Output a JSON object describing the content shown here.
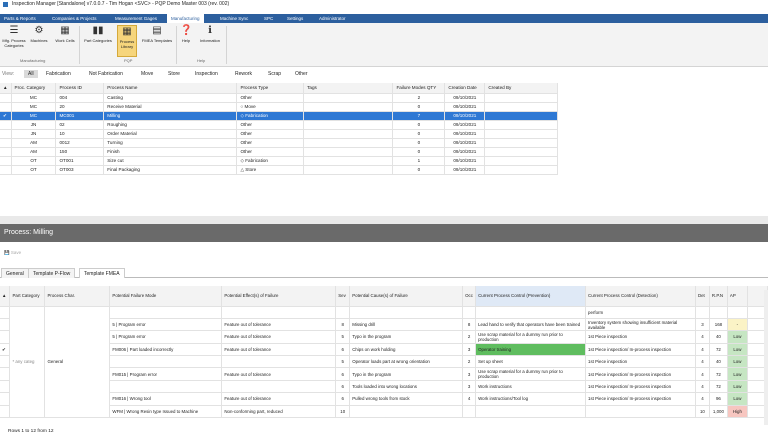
{
  "window": {
    "title": "Inspection Manager [Standalone] v7.0.0.7 - Tim Hogan <SVC> - PQP Demo Master 003 (rev. 002)"
  },
  "menu": [
    "Parts & Reports",
    "Companies & Projects",
    "Measurement Gages",
    "Manufacturing",
    "Machine Sync",
    "SPC",
    "Settings",
    "Administrator"
  ],
  "menu_active": "Manufacturing",
  "ribbon": {
    "manufacturing": [
      "Mfg. Process Categories",
      "Machines",
      "Work Cells"
    ],
    "pqp": [
      "Part Categories",
      "Process Library",
      "FMEA Templates"
    ],
    "help": [
      "Help",
      "Information"
    ],
    "group_labels": [
      "Manufacturing",
      "PQP",
      "Help"
    ]
  },
  "filters": {
    "view_label": "View:",
    "items": [
      "All",
      "Fabrication",
      "Not Fabrication",
      "Move",
      "Store",
      "Inspection",
      "Rework",
      "Scrap",
      "Other"
    ],
    "active": "All"
  },
  "process_table": {
    "headers": [
      "Proc. Category",
      "Process ID",
      "Process Name",
      "Process Type",
      "Tags",
      "Failure Modes QTY",
      "Creation Date",
      "Created By"
    ],
    "rows": [
      [
        "MC",
        "004",
        "Casting",
        "Other",
        "",
        "2",
        "09/10/2021",
        ""
      ],
      [
        "MC",
        "20",
        "Receive Material",
        "Move",
        "",
        "0",
        "09/10/2021",
        ""
      ],
      [
        "MC",
        "MC001",
        "Milling",
        "Fabrication",
        "",
        "7",
        "09/10/2021",
        ""
      ],
      [
        "JN",
        "02",
        "Roughing",
        "Other",
        "",
        "0",
        "09/10/2021",
        ""
      ],
      [
        "JN",
        "10",
        "Order Material",
        "Other",
        "",
        "0",
        "09/10/2021",
        ""
      ],
      [
        "AM",
        "0012",
        "Turning",
        "Other",
        "",
        "0",
        "09/10/2021",
        ""
      ],
      [
        "AM",
        "150",
        "Finish",
        "Other",
        "",
        "0",
        "09/10/2021",
        ""
      ],
      [
        "OT",
        "OT001",
        "Size cut",
        "Fabrication",
        "",
        "1",
        "09/10/2021",
        ""
      ],
      [
        "OT",
        "OT003",
        "Final Packaging",
        "Store",
        "",
        "0",
        "09/10/2021",
        ""
      ]
    ],
    "type_icons": [
      "",
      "circle-icon",
      "diamond-icon",
      "",
      "",
      "",
      "",
      "diamond-icon",
      "triangle-icon"
    ]
  },
  "process_panel": {
    "title": "Process: Milling",
    "save": "Save"
  },
  "tabs": [
    "General",
    "Template P-Flow",
    "Template FMEA"
  ],
  "tab_active": "Template FMEA",
  "fmea": {
    "headers": [
      "Part Category",
      "Process Char.",
      "Potential Failure Mode",
      "Potential Effect(s) of Failure",
      "Sev",
      "Potential Cause(s) of Failure",
      "Occ",
      "Current Process Control (Prevention)",
      "Current Process Control (Detection)",
      "Det",
      "R.P.N",
      "AP"
    ],
    "part_category": "* any categ",
    "process_char": "General",
    "rows": [
      {
        "mode": "",
        "effect": "",
        "sev": "",
        "cause": "",
        "occ": "",
        "prev": "",
        "det_ctrl": "perform",
        "det": "",
        "rpn": "",
        "ap": ""
      },
      {
        "mode": "5 | Program error",
        "effect": "Feature out of tolerance",
        "sev": "8",
        "cause": "Missing drill",
        "occ": "8",
        "prev": "Lead hand to verify that operators have been trained",
        "det_ctrl": "Inventory system showing insufficient material available",
        "det": "3",
        "rpn": "168",
        "ap": "-"
      },
      {
        "mode": "5 | Program error",
        "effect": "Feature out of tolerance",
        "sev": "5",
        "cause": "Typo in the program",
        "occ": "2",
        "prev": "Use scrap material for a dummy run prior to production",
        "det_ctrl": "1st Piece inspection",
        "det": "4",
        "rpn": "40",
        "ap": "Low"
      },
      {
        "mode": "FM006 | Part loaded incorrectly",
        "effect": "Feature out of tolerance",
        "sev": "6",
        "cause": "Chips on work holding",
        "occ": "3",
        "prev": "Operator training",
        "det_ctrl": "1st Piece inspection/ In-process inspection",
        "det": "4",
        "rpn": "72",
        "ap": "Low"
      },
      {
        "mode": "",
        "effect": "",
        "sev": "5",
        "cause": "Operator loads part at wrong orientation",
        "occ": "2",
        "prev": "Set up sheet",
        "det_ctrl": "1st Piece inspection",
        "det": "4",
        "rpn": "40",
        "ap": "Low"
      },
      {
        "mode": "FM015 | Program error",
        "effect": "Feature out of tolerance",
        "sev": "6",
        "cause": "Typo in the program",
        "occ": "3",
        "prev": "Use scrap material for a dummy run prior to production",
        "det_ctrl": "1st Piece inspection/ In-process inspection",
        "det": "4",
        "rpn": "72",
        "ap": "Low"
      },
      {
        "mode": "",
        "effect": "",
        "sev": "6",
        "cause": "Tools loaded into wrong locations",
        "occ": "3",
        "prev": "Work instructions",
        "det_ctrl": "1st Piece inspection/ In-process inspection",
        "det": "4",
        "rpn": "72",
        "ap": "Low"
      },
      {
        "mode": "FM016 | Wrong tool",
        "effect": "Feature out of tolerance",
        "sev": "6",
        "cause": "Pulled wrong tools from stock",
        "occ": "4",
        "prev": "Work instructions/Tool log",
        "det_ctrl": "1st Piece inspection/ In-process inspection",
        "det": "4",
        "rpn": "96",
        "ap": "Low"
      },
      {
        "mode": "WFM | Wrong Resin type Issued to Machine",
        "effect": "Non-conforming part, reduced",
        "sev": "10",
        "cause": "",
        "occ": "",
        "prev": "",
        "det_ctrl": "",
        "det": "10",
        "rpn": "1,000",
        "ap": "High"
      }
    ],
    "highlight_row": 3
  },
  "status": "Rows 1 to 12  from  12"
}
